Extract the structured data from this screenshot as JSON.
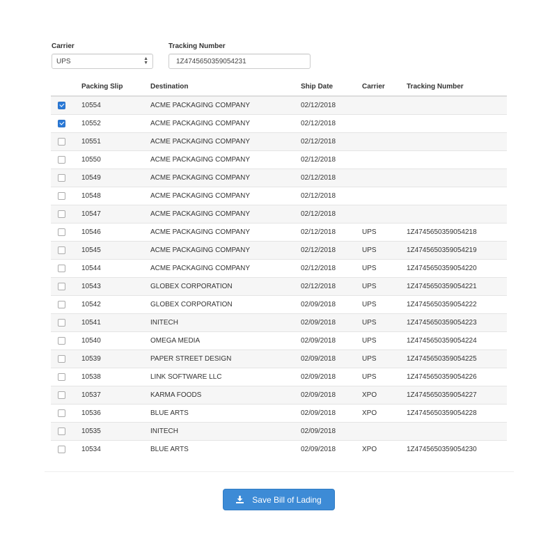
{
  "filters": {
    "carrier_label": "Carrier",
    "carrier_value": "UPS",
    "tracking_label": "Tracking Number",
    "tracking_value": "1Z4745650359054231"
  },
  "table": {
    "headers": [
      "",
      "Packing Slip",
      "Destination",
      "Ship Date",
      "Carrier",
      "Tracking Number"
    ],
    "rows": [
      {
        "checked": true,
        "slip": "10554",
        "destination": "ACME PACKAGING COMPANY",
        "date": "02/12/2018",
        "carrier": "",
        "tracking": ""
      },
      {
        "checked": true,
        "slip": "10552",
        "destination": "ACME PACKAGING COMPANY",
        "date": "02/12/2018",
        "carrier": "",
        "tracking": ""
      },
      {
        "checked": false,
        "slip": "10551",
        "destination": "ACME PACKAGING COMPANY",
        "date": "02/12/2018",
        "carrier": "",
        "tracking": ""
      },
      {
        "checked": false,
        "slip": "10550",
        "destination": "ACME PACKAGING COMPANY",
        "date": "02/12/2018",
        "carrier": "",
        "tracking": ""
      },
      {
        "checked": false,
        "slip": "10549",
        "destination": "ACME PACKAGING COMPANY",
        "date": "02/12/2018",
        "carrier": "",
        "tracking": ""
      },
      {
        "checked": false,
        "slip": "10548",
        "destination": "ACME PACKAGING COMPANY",
        "date": "02/12/2018",
        "carrier": "",
        "tracking": ""
      },
      {
        "checked": false,
        "slip": "10547",
        "destination": "ACME PACKAGING COMPANY",
        "date": "02/12/2018",
        "carrier": "",
        "tracking": ""
      },
      {
        "checked": false,
        "slip": "10546",
        "destination": "ACME PACKAGING COMPANY",
        "date": "02/12/2018",
        "carrier": "UPS",
        "tracking": "1Z4745650359054218"
      },
      {
        "checked": false,
        "slip": "10545",
        "destination": "ACME PACKAGING COMPANY",
        "date": "02/12/2018",
        "carrier": "UPS",
        "tracking": "1Z4745650359054219"
      },
      {
        "checked": false,
        "slip": "10544",
        "destination": "ACME PACKAGING COMPANY",
        "date": "02/12/2018",
        "carrier": "UPS",
        "tracking": "1Z4745650359054220"
      },
      {
        "checked": false,
        "slip": "10543",
        "destination": "GLOBEX CORPORATION",
        "date": "02/12/2018",
        "carrier": "UPS",
        "tracking": "1Z4745650359054221"
      },
      {
        "checked": false,
        "slip": "10542",
        "destination": "GLOBEX CORPORATION",
        "date": "02/09/2018",
        "carrier": "UPS",
        "tracking": "1Z4745650359054222"
      },
      {
        "checked": false,
        "slip": "10541",
        "destination": "INITECH",
        "date": "02/09/2018",
        "carrier": "UPS",
        "tracking": "1Z4745650359054223"
      },
      {
        "checked": false,
        "slip": "10540",
        "destination": "OMEGA MEDIA",
        "date": "02/09/2018",
        "carrier": "UPS",
        "tracking": "1Z4745650359054224"
      },
      {
        "checked": false,
        "slip": "10539",
        "destination": "PAPER STREET DESIGN",
        "date": "02/09/2018",
        "carrier": "UPS",
        "tracking": "1Z4745650359054225"
      },
      {
        "checked": false,
        "slip": "10538",
        "destination": "LINK SOFTWARE LLC",
        "date": "02/09/2018",
        "carrier": "UPS",
        "tracking": "1Z4745650359054226"
      },
      {
        "checked": false,
        "slip": "10537",
        "destination": "KARMA FOODS",
        "date": "02/09/2018",
        "carrier": "XPO",
        "tracking": "1Z4745650359054227"
      },
      {
        "checked": false,
        "slip": "10536",
        "destination": "BLUE ARTS",
        "date": "02/09/2018",
        "carrier": "XPO",
        "tracking": "1Z4745650359054228"
      },
      {
        "checked": false,
        "slip": "10535",
        "destination": "INITECH",
        "date": "02/09/2018",
        "carrier": "",
        "tracking": ""
      },
      {
        "checked": false,
        "slip": "10534",
        "destination": "BLUE ARTS",
        "date": "02/09/2018",
        "carrier": "XPO",
        "tracking": "1Z4745650359054230"
      }
    ]
  },
  "actions": {
    "save_label": "Save Bill of Lading",
    "save_icon": "download-icon",
    "accent_color": "#3d8bd6"
  }
}
